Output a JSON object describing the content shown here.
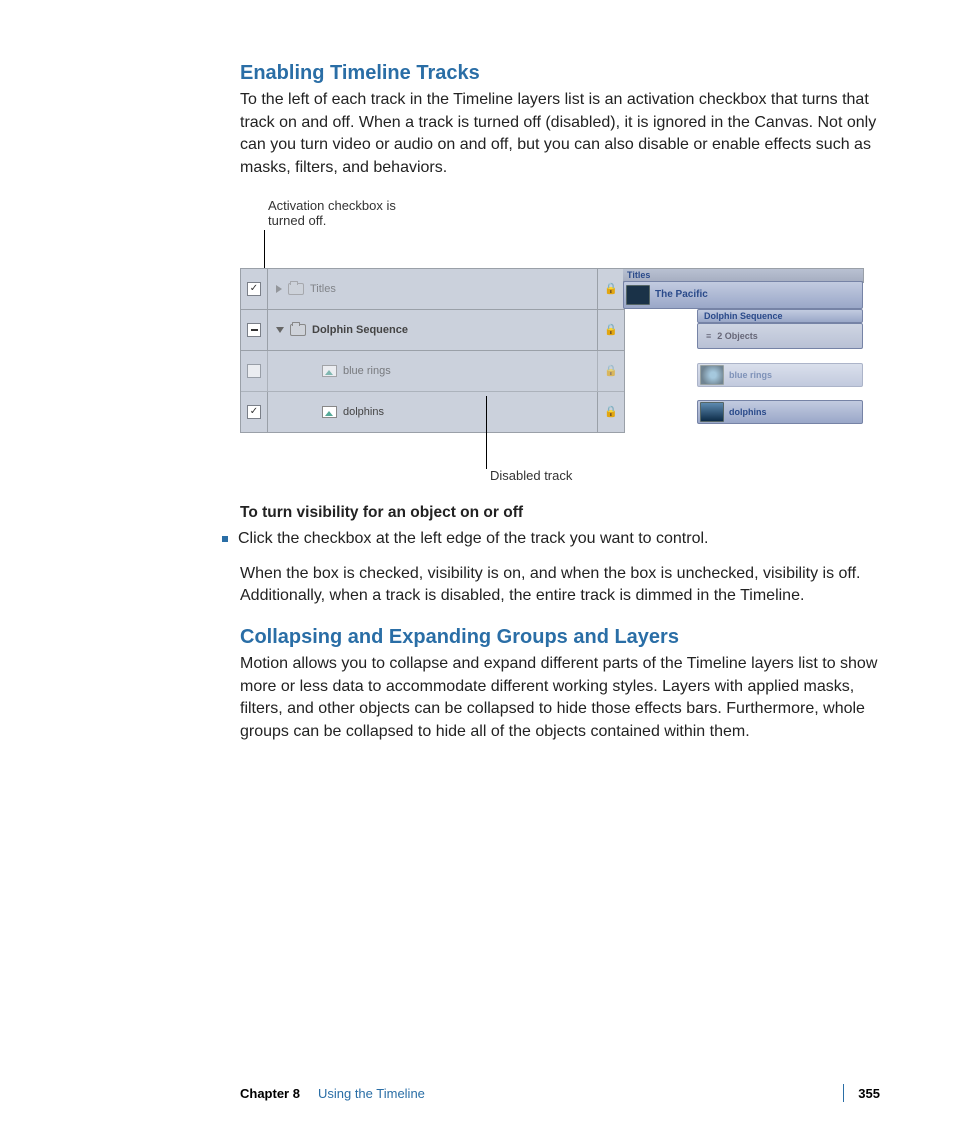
{
  "section1": {
    "heading": "Enabling Timeline Tracks",
    "para1": "To the left of each track in the Timeline layers list is an activation checkbox that turns that track on and off. When a track is turned off (disabled), it is ignored in the Canvas. Not only can you turn video or audio on and off, but you can also disable or enable effects such as masks, filters, and behaviors."
  },
  "figure": {
    "callout_top": "Activation checkbox is turned off.",
    "callout_bottom": "Disabled track",
    "header_clip": "Titles",
    "tracks": [
      {
        "name": "Titles",
        "checkbox": "checked",
        "expand": "right",
        "icon": "folder",
        "dim": true
      },
      {
        "name": "Dolphin Sequence",
        "checkbox": "dash",
        "expand": "down",
        "icon": "folder",
        "dim": false
      },
      {
        "name": "blue rings",
        "checkbox": "empty",
        "expand": "none",
        "icon": "image",
        "dim": true
      },
      {
        "name": "dolphins",
        "checkbox": "checked",
        "expand": "none",
        "icon": "image",
        "dim": false
      }
    ],
    "clips": {
      "pacific": "The Pacific",
      "dseq": "Dolphin Sequence",
      "objects": "2 Objects",
      "bluerings": "blue rings",
      "dolphins": "dolphins"
    }
  },
  "instructions": {
    "heading": "To turn visibility for an object on or off",
    "bullet": "Click the checkbox at the left edge of the track you want to control.",
    "result": "When the box is checked, visibility is on, and when the box is unchecked, visibility is off. Additionally, when a track is disabled, the entire track is dimmed in the Timeline."
  },
  "section2": {
    "heading": "Collapsing and Expanding Groups and Layers",
    "para1": "Motion allows you to collapse and expand different parts of the Timeline layers list to show more or less data to accommodate different working styles. Layers with applied masks, filters, and other objects can be collapsed to hide those effects bars. Furthermore, whole groups can be collapsed to hide all of the objects contained within them."
  },
  "footer": {
    "chapter": "Chapter 8",
    "title": "Using the Timeline",
    "page": "355"
  }
}
